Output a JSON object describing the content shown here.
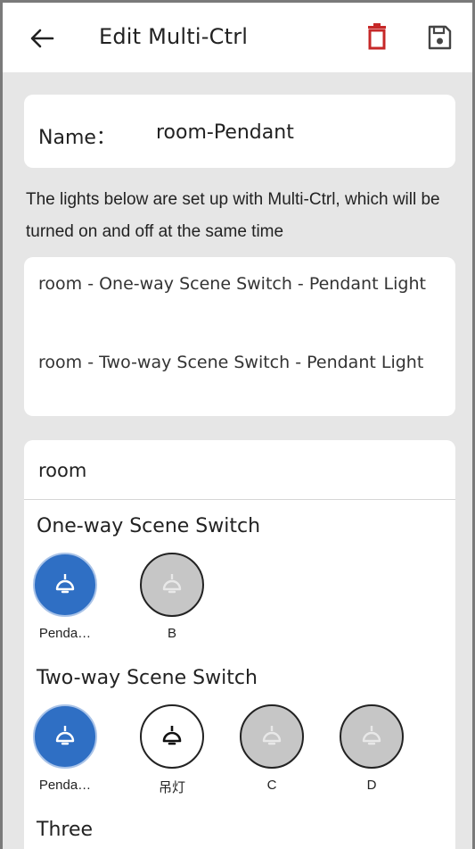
{
  "header": {
    "title": "Edit Multi-Ctrl",
    "back_icon": "arrow-left-icon",
    "delete_icon": "trash-icon",
    "save_icon": "floppy-disk-icon",
    "delete_color": "#c62828"
  },
  "name_card": {
    "label": "Name：",
    "value": "room-Pendant"
  },
  "description": "The lights below are set up with Multi-Ctrl, which will be turned on and off at the same time",
  "linked_lights": [
    "room - One-way Scene Switch - Pendant Light",
    "room - Two-way Scene Switch - Pendant Light"
  ],
  "room": {
    "name": "room",
    "sections": [
      {
        "title": "One-way Scene Switch",
        "devices": [
          {
            "label": "Penda…",
            "state": "on"
          },
          {
            "label": "B",
            "state": "offline"
          }
        ]
      },
      {
        "title": "Two-way Scene Switch",
        "devices": [
          {
            "label": "Penda…",
            "state": "on"
          },
          {
            "label": "吊灯",
            "state": "off"
          },
          {
            "label": "C",
            "state": "offline"
          },
          {
            "label": "D",
            "state": "offline"
          }
        ]
      },
      {
        "title": "Three",
        "devices": []
      }
    ]
  },
  "colors": {
    "accent": "#2f6fc4",
    "background": "#e6e6e6",
    "offline": "#c6c6c6"
  }
}
